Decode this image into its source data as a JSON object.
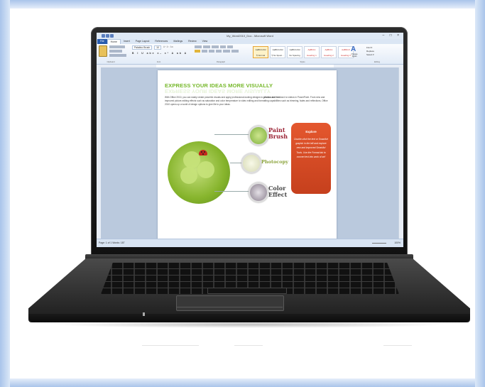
{
  "window": {
    "title": "My_Word2010_Doc - Microsoft Word",
    "controls": "–  □  ×"
  },
  "ribbon": {
    "tabs": [
      "File",
      "Home",
      "Insert",
      "Page Layout",
      "References",
      "Mailings",
      "Review",
      "View"
    ],
    "paste_label": "Paste",
    "font_name": "Palatino Brush",
    "font_size": "10",
    "styles": [
      "AaBbCcDd",
      "AaBbCcDd",
      "AaBbCcDd",
      "AaBbCc",
      "AaBbCc",
      "AaBbCcI"
    ],
    "style_names": [
      "¶ Normal",
      "¶ No Spaci...",
      "No Spacing",
      "Heading 1",
      "Heading 2",
      "Heading 3"
    ],
    "change_styles": "Change Styles",
    "editing": [
      "Find ▾",
      "Replace",
      "Select ▾"
    ],
    "group_labels": [
      "Clipboard",
      "Font",
      "Paragraph",
      "Styles",
      "Editing"
    ]
  },
  "document": {
    "title": "EXPRESS YOUR IDEAS MORE VISUALLY",
    "body_pre": "With Office 2010, you can easily create powerful visuals and apply professional-looking designs to ",
    "body_bold": "photos and text",
    "body_post": " and to videos in PowerPoint. From new and improved picture-editing effects such as saturation and color temperature to video editing and formatting capabilities such as trimming, fades and reflections, Office 2010 opens up a world of design options to give life to your ideas.",
    "nodes": [
      "Paint Brush",
      "Photocopy",
      "Color Effect"
    ],
    "explore": {
      "heading": "Explore",
      "text": "Double-click the text or SmartArt graphic in the left and explore new and improved SmartArt Tools. Use the Format tab to convert text into work of art!"
    }
  },
  "statusbar": {
    "left": "Page: 1 of 1   Words: 187",
    "zoom": "100%"
  },
  "colors": {
    "title_green": "#76b82a",
    "file_tab_blue": "#2a5cad",
    "explore_orange": "#e4572e",
    "frame_blue": "#a9c4ea"
  }
}
